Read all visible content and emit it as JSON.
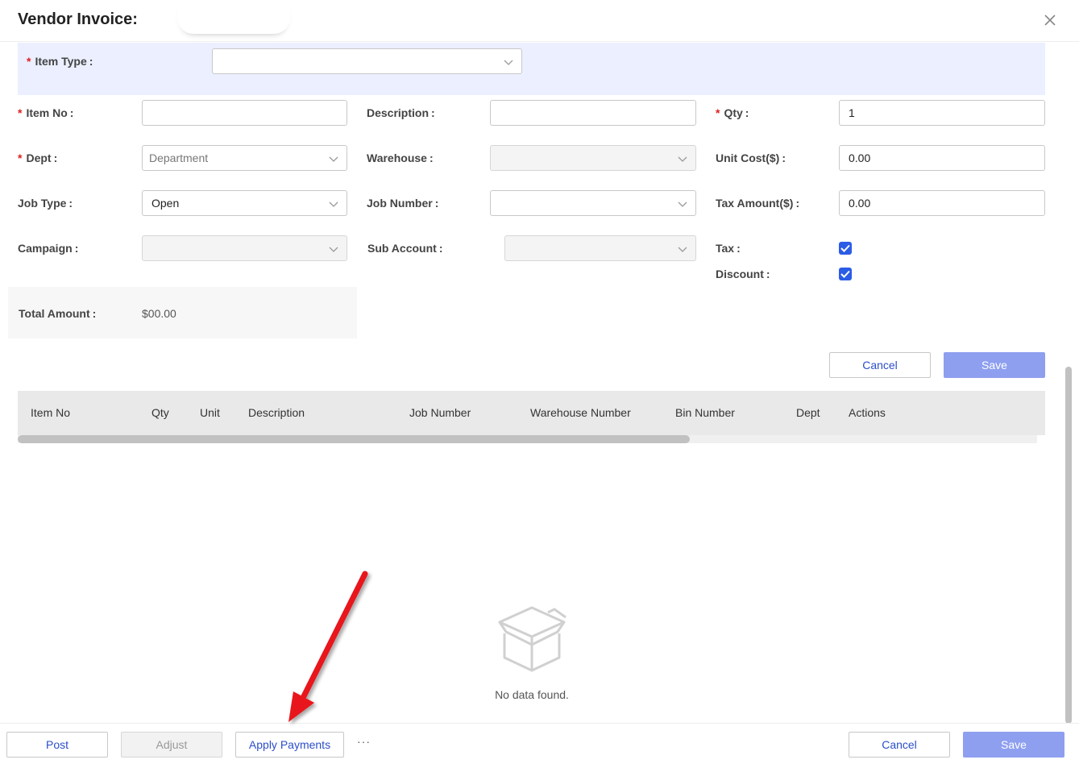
{
  "header": {
    "title": "Vendor Invoice:"
  },
  "form": {
    "item_type": {
      "label": "Item Type",
      "value": ""
    },
    "item_no": {
      "label": "Item No",
      "value": ""
    },
    "description": {
      "label": "Description",
      "value": ""
    },
    "qty": {
      "label": "Qty",
      "value": "1"
    },
    "dept": {
      "label": "Dept",
      "placeholder": "Department"
    },
    "warehouse": {
      "label": "Warehouse",
      "value": ""
    },
    "unit_cost": {
      "label": "Unit Cost($)",
      "value": "0.00"
    },
    "job_type": {
      "label": "Job Type",
      "value": "Open"
    },
    "job_number": {
      "label": "Job Number",
      "value": ""
    },
    "tax_amount": {
      "label": "Tax Amount($)",
      "value": "0.00"
    },
    "campaign": {
      "label": "Campaign",
      "value": ""
    },
    "sub_account": {
      "label": "Sub Account",
      "value": ""
    },
    "tax": {
      "label": "Tax",
      "checked": true
    },
    "discount": {
      "label": "Discount",
      "checked": true
    },
    "total_amount": {
      "label": "Total Amount",
      "value": "$00.00"
    },
    "cancel_label": "Cancel",
    "save_label": "Save"
  },
  "table": {
    "columns": [
      "Item No",
      "Qty",
      "Unit",
      "Description",
      "Job Number",
      "Warehouse Number",
      "Bin Number",
      "Dept",
      "Actions"
    ],
    "empty_text": "No data found."
  },
  "footer": {
    "post_label": "Post",
    "adjust_label": "Adjust",
    "apply_payments_label": "Apply Payments",
    "more_label": "···",
    "cancel_label": "Cancel",
    "save_label": "Save"
  },
  "colors": {
    "accent": "#2b5ce6",
    "primary_button": "#8e9ff0",
    "required_star": "#e02020",
    "annotation_arrow": "#e8141b"
  }
}
